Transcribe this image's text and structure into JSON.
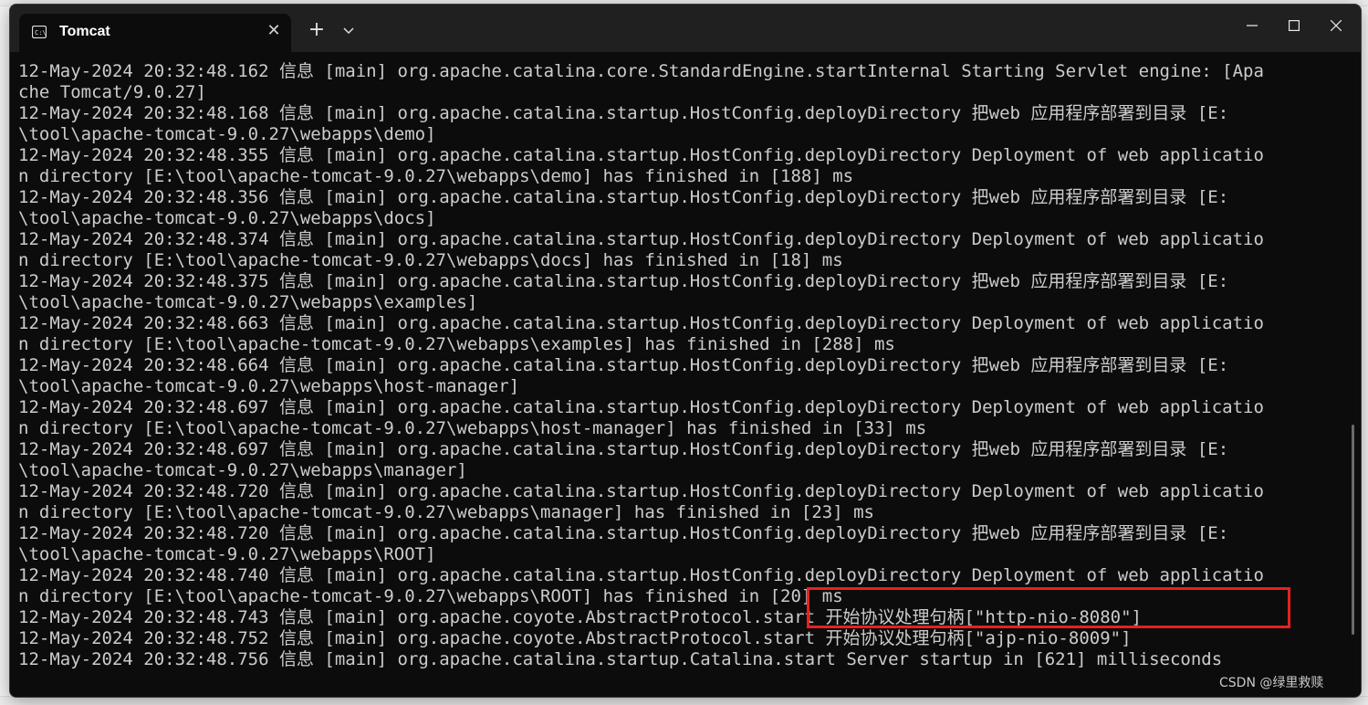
{
  "window": {
    "tab_title": "Tomcat",
    "new_tab_symbol": "+",
    "dropdown_symbol": "⌄",
    "close_tab_symbol": "✕",
    "minimize_symbol": "—",
    "maximize_symbol": "☐",
    "close_symbol": "✕"
  },
  "console": {
    "lines": [
      "12-May-2024 20:32:48.162 信息 [main] org.apache.catalina.core.StandardEngine.startInternal Starting Servlet engine: [Apa",
      "che Tomcat/9.0.27]",
      "12-May-2024 20:32:48.168 信息 [main] org.apache.catalina.startup.HostConfig.deployDirectory 把web 应用程序部署到目录 [E:",
      "\\tool\\apache-tomcat-9.0.27\\webapps\\demo]",
      "12-May-2024 20:32:48.355 信息 [main] org.apache.catalina.startup.HostConfig.deployDirectory Deployment of web applicatio",
      "n directory [E:\\tool\\apache-tomcat-9.0.27\\webapps\\demo] has finished in [188] ms",
      "12-May-2024 20:32:48.356 信息 [main] org.apache.catalina.startup.HostConfig.deployDirectory 把web 应用程序部署到目录 [E:",
      "\\tool\\apache-tomcat-9.0.27\\webapps\\docs]",
      "12-May-2024 20:32:48.374 信息 [main] org.apache.catalina.startup.HostConfig.deployDirectory Deployment of web applicatio",
      "n directory [E:\\tool\\apache-tomcat-9.0.27\\webapps\\docs] has finished in [18] ms",
      "12-May-2024 20:32:48.375 信息 [main] org.apache.catalina.startup.HostConfig.deployDirectory 把web 应用程序部署到目录 [E:",
      "\\tool\\apache-tomcat-9.0.27\\webapps\\examples]",
      "12-May-2024 20:32:48.663 信息 [main] org.apache.catalina.startup.HostConfig.deployDirectory Deployment of web applicatio",
      "n directory [E:\\tool\\apache-tomcat-9.0.27\\webapps\\examples] has finished in [288] ms",
      "12-May-2024 20:32:48.664 信息 [main] org.apache.catalina.startup.HostConfig.deployDirectory 把web 应用程序部署到目录 [E:",
      "\\tool\\apache-tomcat-9.0.27\\webapps\\host-manager]",
      "12-May-2024 20:32:48.697 信息 [main] org.apache.catalina.startup.HostConfig.deployDirectory Deployment of web applicatio",
      "n directory [E:\\tool\\apache-tomcat-9.0.27\\webapps\\host-manager] has finished in [33] ms",
      "12-May-2024 20:32:48.697 信息 [main] org.apache.catalina.startup.HostConfig.deployDirectory 把web 应用程序部署到目录 [E:",
      "\\tool\\apache-tomcat-9.0.27\\webapps\\manager]",
      "12-May-2024 20:32:48.720 信息 [main] org.apache.catalina.startup.HostConfig.deployDirectory Deployment of web applicatio",
      "n directory [E:\\tool\\apache-tomcat-9.0.27\\webapps\\manager] has finished in [23] ms",
      "12-May-2024 20:32:48.720 信息 [main] org.apache.catalina.startup.HostConfig.deployDirectory 把web 应用程序部署到目录 [E:",
      "\\tool\\apache-tomcat-9.0.27\\webapps\\ROOT]",
      "12-May-2024 20:32:48.740 信息 [main] org.apache.catalina.startup.HostConfig.deployDirectory Deployment of web applicatio",
      "n directory [E:\\tool\\apache-tomcat-9.0.27\\webapps\\ROOT] has finished in [20] ms",
      "12-May-2024 20:32:48.743 信息 [main] org.apache.coyote.AbstractProtocol.start 开始协议处理句柄[\"http-nio-8080\"]",
      "12-May-2024 20:32:48.752 信息 [main] org.apache.coyote.AbstractProtocol.start 开始协议处理句柄[\"ajp-nio-8009\"]",
      "12-May-2024 20:32:48.756 信息 [main] org.apache.catalina.startup.Catalina.start Server startup in [621] milliseconds"
    ]
  },
  "watermark": "CSDN @绿里救赎",
  "colors": {
    "console_bg": "#0c0c0c",
    "console_text": "#cccccc",
    "titlebar_bg": "#202020",
    "highlight": "#e8211e"
  }
}
